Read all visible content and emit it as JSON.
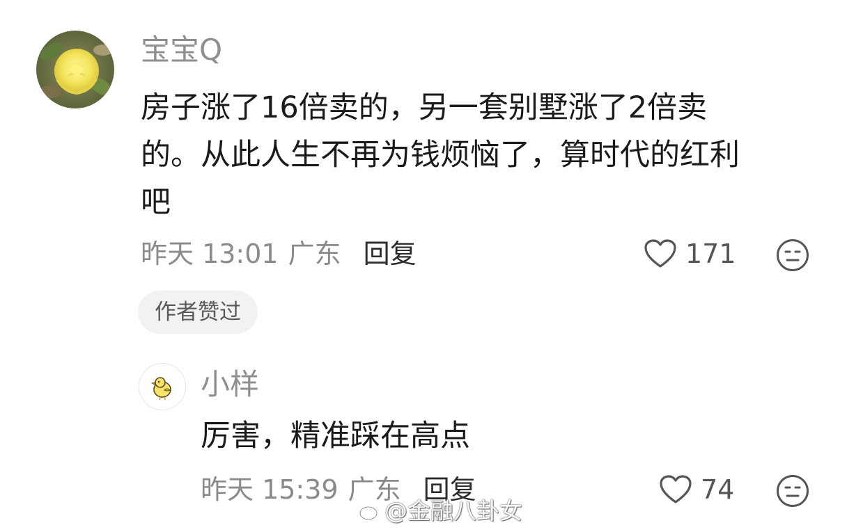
{
  "comments": [
    {
      "username": "宝宝Q",
      "avatar_icon": "yellow-rose-avatar",
      "text_lines": [
        "房子涨了16倍卖的，另一套别墅涨了2倍卖",
        "的。从此人生不再为钱烦恼了，算时代的红利",
        "吧"
      ],
      "time": "昨天 13:01",
      "location": "广东",
      "reply_label": "回复",
      "like_icon": "heart-icon",
      "likes": "171",
      "reaction_icon": "neutral-face-icon",
      "badge": "作者赞过"
    },
    {
      "username": "小样",
      "avatar_icon": "chick-avatar",
      "text_lines": [
        "厉害，精准踩在高点"
      ],
      "time": "昨天 15:39",
      "location": "广东",
      "reply_label": "回复",
      "like_icon": "heart-icon",
      "likes": "74",
      "reaction_icon": "neutral-face-icon"
    }
  ],
  "watermark": {
    "text": "@金融八卦女",
    "logo_icon": "weibo-logo-icon"
  },
  "colors": {
    "username": "#8f8f8f",
    "body_text": "#1a1a1a",
    "meta_text": "#8a8a8a",
    "badge_bg": "#f2f2f2"
  }
}
